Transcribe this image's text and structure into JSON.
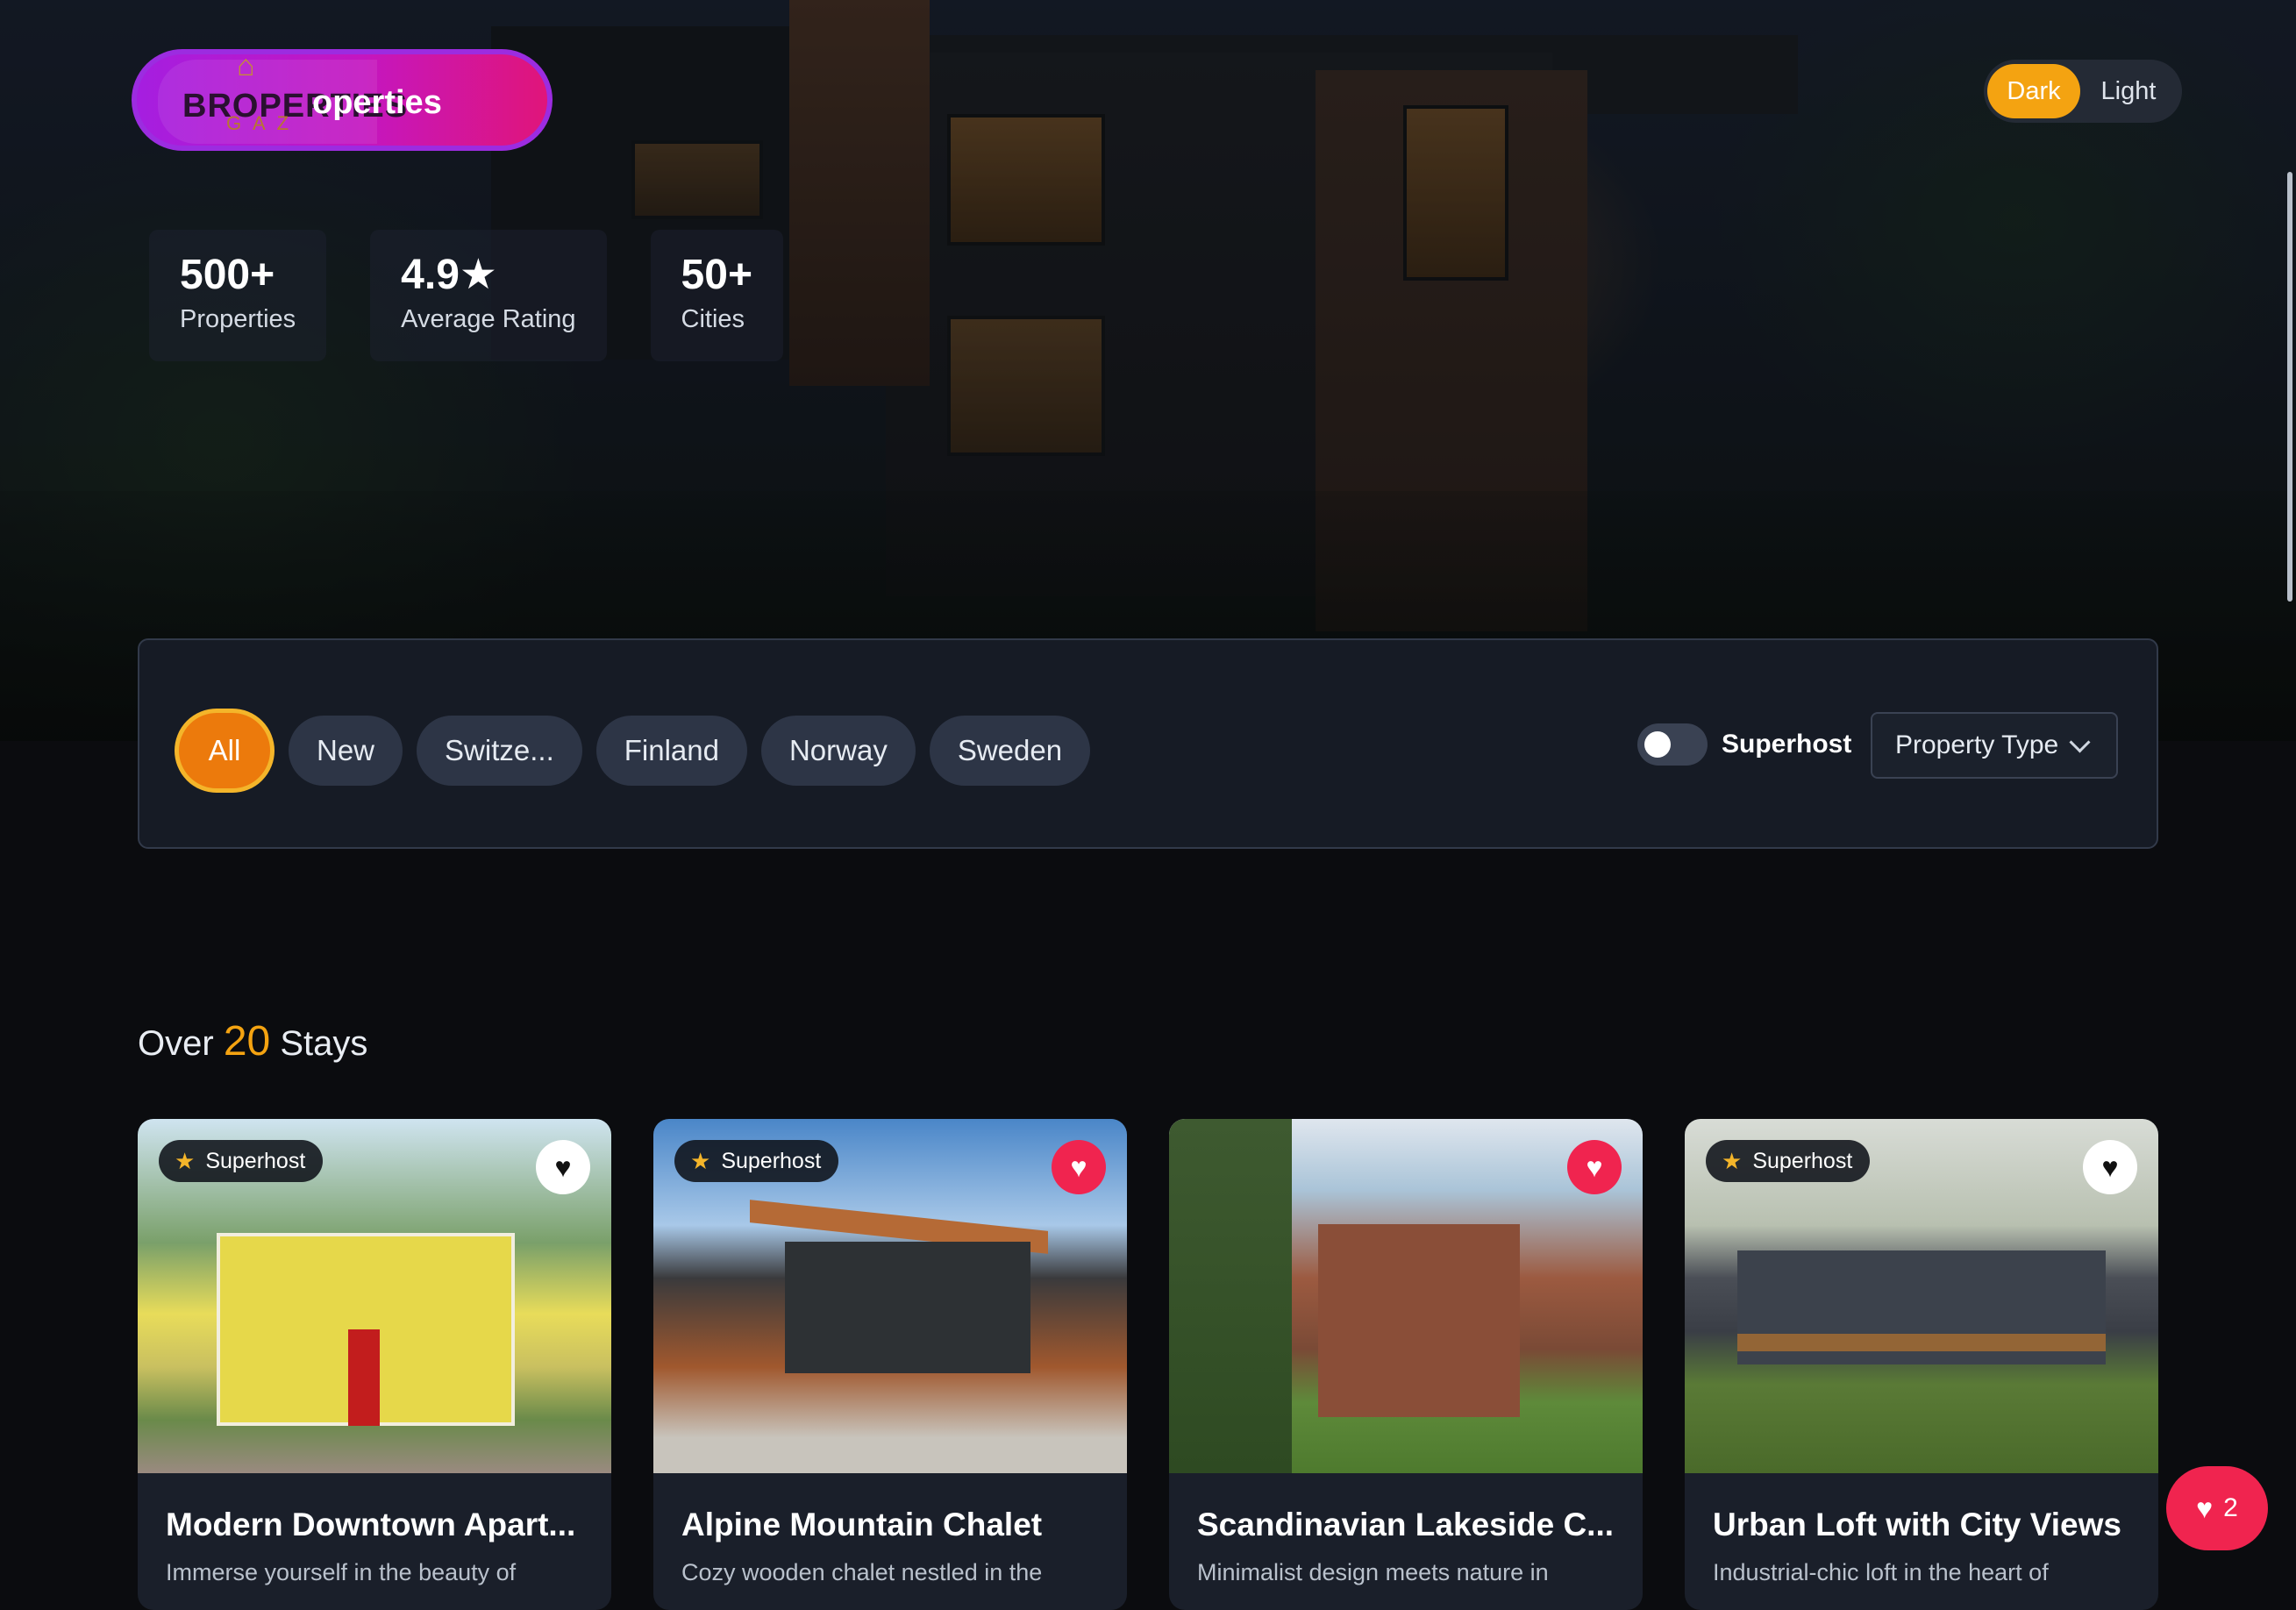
{
  "brand": {
    "logo_overlay_text": "BROPERTIES",
    "logo_sub": "G A Z",
    "logo_text": "operties"
  },
  "theme": {
    "dark_label": "Dark",
    "light_label": "Light",
    "selected": "Dark"
  },
  "stats": [
    {
      "value": "500+",
      "label": "Properties"
    },
    {
      "value": "4.9★",
      "label": "Average Rating"
    },
    {
      "value": "50+",
      "label": "Cities"
    }
  ],
  "filters": {
    "chips": [
      {
        "label": "All",
        "active": true
      },
      {
        "label": "New",
        "active": false
      },
      {
        "label": "Switze...",
        "active": false
      },
      {
        "label": "Finland",
        "active": false
      },
      {
        "label": "Norway",
        "active": false
      },
      {
        "label": "Sweden",
        "active": false
      }
    ],
    "superhost_label": "Superhost",
    "superhost_on": false,
    "property_type_label": "Property Type"
  },
  "listings": {
    "title_prefix": "Over",
    "count": "20",
    "title_suffix": "Stays",
    "cards": [
      {
        "title": "Modern Downtown Apart...",
        "desc": "Immerse yourself in the beauty of",
        "superhost": true,
        "badge": "Superhost",
        "favorited": false
      },
      {
        "title": "Alpine Mountain Chalet",
        "desc": "Cozy wooden chalet nestled in the",
        "superhost": true,
        "badge": "Superhost",
        "favorited": true
      },
      {
        "title": "Scandinavian Lakeside C...",
        "desc": "Minimalist design meets nature in",
        "superhost": false,
        "badge": "",
        "favorited": true
      },
      {
        "title": "Urban Loft with City Views",
        "desc": "Industrial-chic loft in the heart of",
        "superhost": true,
        "badge": "Superhost",
        "favorited": false
      }
    ]
  },
  "favorites_count": "2",
  "colors": {
    "accent": "#f4a311",
    "chip_active": "#ec7a0c",
    "favorite": "#f0244f",
    "panel": "#161b25"
  },
  "icons": {
    "star": "star-icon",
    "heart": "heart-icon",
    "chevron": "chevron-down-icon"
  }
}
